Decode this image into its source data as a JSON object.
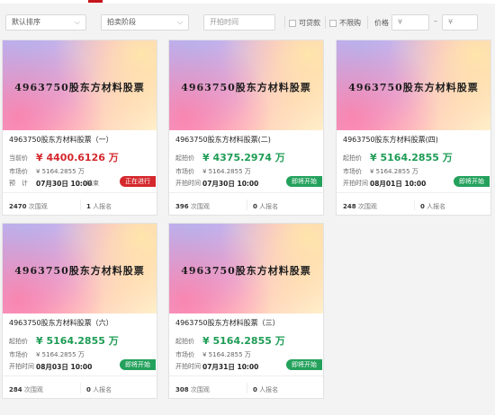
{
  "filters": {
    "sort": "默认排序",
    "stage": "拍卖阶段",
    "start_time_placeholder": "开拍时间",
    "loan_label": "可贷款",
    "no_limit_label": "不限购",
    "price_label": "价格",
    "price_min_placeholder": "¥",
    "price_max_placeholder": "¥",
    "range_dash": "–"
  },
  "cards": [
    {
      "banner": "4963750股东方材料股票",
      "title": "4963750股东方材料股票（一）",
      "price_label": "当前价",
      "price": "¥ 4400.6126 万",
      "price_color": "#d4282d",
      "market_label": "市场价",
      "market_price": "¥ 5164.2855 万",
      "time_label": "预　计",
      "time": "07月30日 10:00",
      "time_extra": "结束",
      "status": "正在进行",
      "status_color": "#d4282d",
      "views_count": "2470",
      "views_label": "次围观",
      "signup_count": "1",
      "signup_label": "人报名"
    },
    {
      "banner": "4963750股东方材料股票",
      "title": "4963750股东方材料股票(二)",
      "price_label": "起拍价",
      "price": "¥ 4375.2974 万",
      "price_color": "#1e9c55",
      "market_label": "市场价",
      "market_price": "¥ 5164.2855 万",
      "time_label": "开拍时间",
      "time": "07月30日 10:00",
      "time_extra": "",
      "status": "即将开始",
      "status_color": "#23a15c",
      "views_count": "396",
      "views_label": "次围观",
      "signup_count": "0",
      "signup_label": "人报名"
    },
    {
      "banner": "4963750股东方材料股票",
      "title": "4963750股东方材料股票(四)",
      "price_label": "起拍价",
      "price": "¥ 5164.2855 万",
      "price_color": "#1e9c55",
      "market_label": "市场价",
      "market_price": "¥ 5164.2855 万",
      "time_label": "开拍时间",
      "time": "08月01日 10:00",
      "time_extra": "",
      "status": "即将开始",
      "status_color": "#23a15c",
      "views_count": "248",
      "views_label": "次围观",
      "signup_count": "0",
      "signup_label": "人报名"
    },
    {
      "banner": "4963750股东方材料股票",
      "title": "4963750股东方材料股票（六）",
      "price_label": "起拍价",
      "price": "¥ 5164.2855 万",
      "price_color": "#1e9c55",
      "market_label": "市场价",
      "market_price": "¥ 5164.2855 万",
      "time_label": "开拍时间",
      "time": "08月03日 10:00",
      "time_extra": "",
      "status": "即将开始",
      "status_color": "#23a15c",
      "views_count": "284",
      "views_label": "次围观",
      "signup_count": "0",
      "signup_label": "人报名"
    },
    {
      "banner": "4963750股东方材料股票",
      "title": "4963750股东方材料股票（三）",
      "price_label": "起拍价",
      "price": "¥ 5164.2855 万",
      "price_color": "#1e9c55",
      "market_label": "市场价",
      "market_price": "¥ 5164.2855 万",
      "time_label": "开拍时间",
      "time": "07月31日 10:00",
      "time_extra": "",
      "status": "即将开始",
      "status_color": "#23a15c",
      "views_count": "308",
      "views_label": "次围观",
      "signup_count": "0",
      "signup_label": "人报名"
    }
  ],
  "side_tools": [
    "star-icon",
    "tag-icon",
    "chat-icon",
    "edit-icon",
    "home-icon",
    "more-icon"
  ]
}
